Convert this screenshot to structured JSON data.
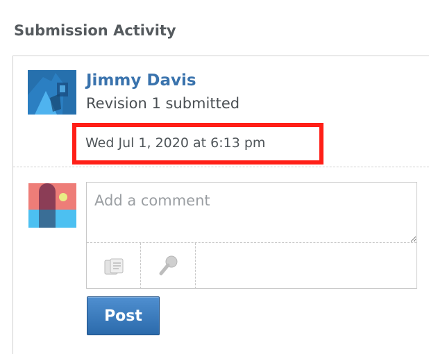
{
  "section": {
    "title": "Submission Activity"
  },
  "activity": {
    "author": "Jimmy Davis",
    "action": "Revision 1 submitted",
    "timestamp": "Wed Jul 1, 2020 at 6:13 pm",
    "highlight_color": "#ff1f17"
  },
  "composer": {
    "placeholder": "Add a comment",
    "value": "",
    "tools": [
      {
        "icon": "attachment-icon"
      },
      {
        "icon": "microphone-icon"
      }
    ],
    "post_label": "Post"
  },
  "colors": {
    "link": "#3a73ad",
    "button": "#2b6aab",
    "border": "#cfcfcf"
  }
}
